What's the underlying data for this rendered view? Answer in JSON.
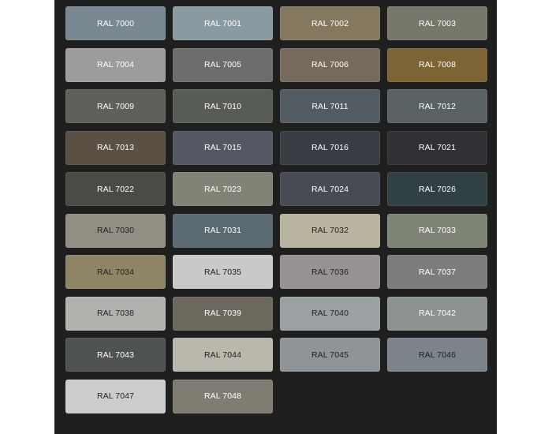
{
  "swatches": [
    {
      "label": "RAL 7000",
      "color": "#7a8891",
      "text": "#ffffff"
    },
    {
      "label": "RAL 7001",
      "color": "#8a9aa1",
      "text": "#ffffff"
    },
    {
      "label": "RAL 7002",
      "color": "#84795f",
      "text": "#ffffff"
    },
    {
      "label": "RAL 7003",
      "color": "#78776b",
      "text": "#ffffff"
    },
    {
      "label": "RAL 7004",
      "color": "#9c9c9e",
      "text": "#ffffff"
    },
    {
      "label": "RAL 7005",
      "color": "#6b6e6a",
      "text": "#ffffff"
    },
    {
      "label": "RAL 7006",
      "color": "#766a5d",
      "text": "#ffffff"
    },
    {
      "label": "RAL 7008",
      "color": "#7c6434",
      "text": "#ffffff"
    },
    {
      "label": "RAL 7009",
      "color": "#5d6159",
      "text": "#ffffff"
    },
    {
      "label": "RAL 7010",
      "color": "#575d55",
      "text": "#ffffff"
    },
    {
      "label": "RAL 7011",
      "color": "#525a62",
      "text": "#ffffff"
    },
    {
      "label": "RAL 7012",
      "color": "#5a6265",
      "text": "#ffffff"
    },
    {
      "label": "RAL 7013",
      "color": "#5a5043",
      "text": "#ffffff"
    },
    {
      "label": "RAL 7015",
      "color": "#535863",
      "text": "#ffffff"
    },
    {
      "label": "RAL 7016",
      "color": "#383d43",
      "text": "#ffffff"
    },
    {
      "label": "RAL 7021",
      "color": "#2f3134",
      "text": "#ffffff"
    },
    {
      "label": "RAL 7022",
      "color": "#4c4a44",
      "text": "#ffffff"
    },
    {
      "label": "RAL 7023",
      "color": "#818377",
      "text": "#ffffff"
    },
    {
      "label": "RAL 7024",
      "color": "#474b53",
      "text": "#ffffff"
    },
    {
      "label": "RAL 7026",
      "color": "#314044",
      "text": "#ffffff"
    },
    {
      "label": "RAL 7030",
      "color": "#928e84",
      "text": "#222222"
    },
    {
      "label": "RAL 7031",
      "color": "#5b6971",
      "text": "#ffffff"
    },
    {
      "label": "RAL 7032",
      "color": "#b9b4a0",
      "text": "#222222"
    },
    {
      "label": "RAL 7033",
      "color": "#7e8476",
      "text": "#ffffff"
    },
    {
      "label": "RAL 7034",
      "color": "#8e8466",
      "text": "#222222"
    },
    {
      "label": "RAL 7035",
      "color": "#c7cac7",
      "text": "#222222"
    },
    {
      "label": "RAL 7036",
      "color": "#969293",
      "text": "#222222"
    },
    {
      "label": "RAL 7037",
      "color": "#7b7c7d",
      "text": "#ffffff"
    },
    {
      "label": "RAL 7038",
      "color": "#b1b2ad",
      "text": "#222222"
    },
    {
      "label": "RAL 7039",
      "color": "#6c685e",
      "text": "#ffffff"
    },
    {
      "label": "RAL 7040",
      "color": "#9ba1a3",
      "text": "#222222"
    },
    {
      "label": "RAL 7042",
      "color": "#8c9192",
      "text": "#ffffff"
    },
    {
      "label": "RAL 7043",
      "color": "#4f5252",
      "text": "#ffffff"
    },
    {
      "label": "RAL 7044",
      "color": "#bab8ac",
      "text": "#222222"
    },
    {
      "label": "RAL 7045",
      "color": "#8f9499",
      "text": "#222222"
    },
    {
      "label": "RAL 7046",
      "color": "#7b838b",
      "text": "#222222"
    },
    {
      "label": "RAL 7047",
      "color": "#cbcccd",
      "text": "#222222"
    },
    {
      "label": "RAL 7048",
      "color": "#817c72",
      "text": "#ffffff"
    }
  ]
}
